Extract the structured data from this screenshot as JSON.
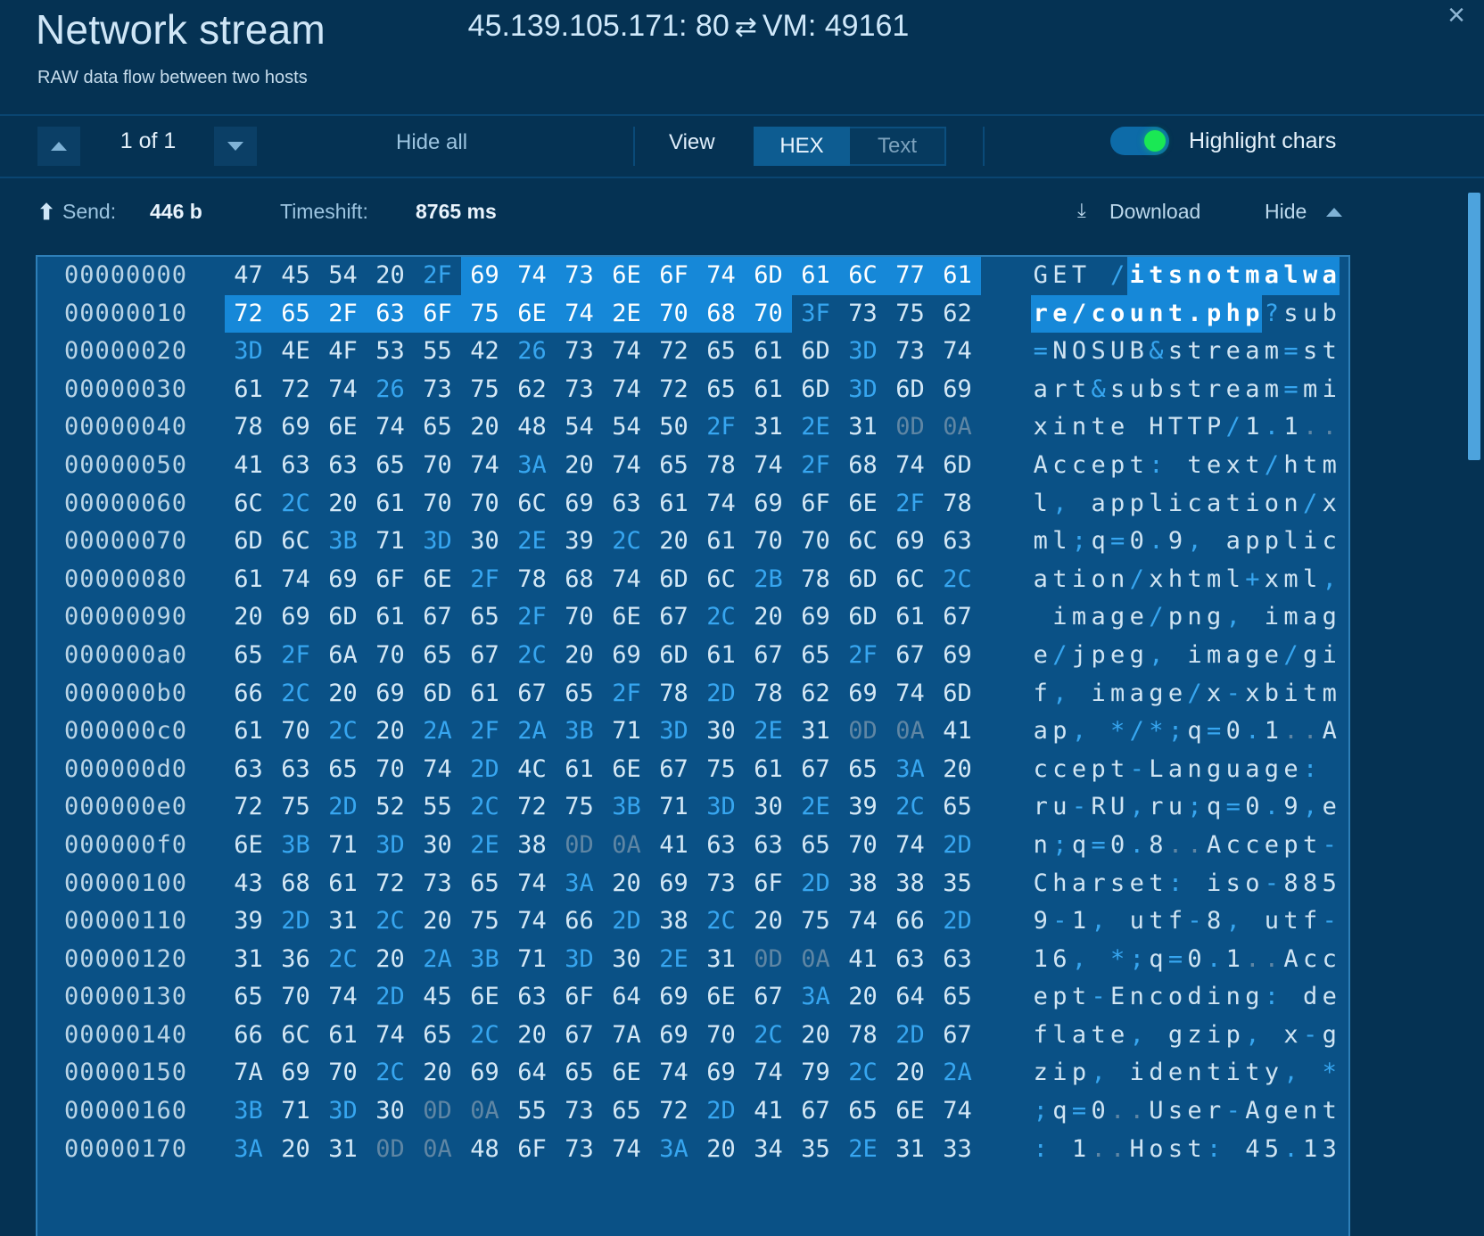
{
  "header": {
    "title": "Network stream",
    "subtitle": "RAW data flow between two hosts",
    "connection": "45.139.105.171: 80",
    "swap_icon": "⇄",
    "connection_right": "VM: 49161",
    "close_icon": "×"
  },
  "toolbar": {
    "prev_icon": "chevron-up-icon",
    "next_icon": "chevron-down-icon",
    "counter": "1 of 1",
    "hide_all": "Hide all",
    "view_label": "View",
    "view_modes": [
      "HEX",
      "Text"
    ],
    "view_selected": "HEX",
    "highlight_chars_label": "Highlight chars",
    "highlight_chars_on": true
  },
  "infobar": {
    "send_arrow": "⬆",
    "send_label": "Send:",
    "send_value": "446 b",
    "timeshift_label": "Timeshift:",
    "timeshift_value": "8765 ms",
    "download_label": "Download",
    "download_icon": "⤓",
    "hide_label": "Hide"
  },
  "colors": {
    "app_bg": "#053253",
    "panel_bg": "#0a5186",
    "panel_border": "#2e7fb8",
    "highlight": "#1688d8",
    "special_char": "#37a6f0",
    "control_char": "#5f86a4",
    "accent_green": "#1ae854",
    "segment_active": "#0d5c91",
    "scrollbar": "#4da3dd"
  },
  "hexdump": {
    "bytes_per_row": 16,
    "rows": [
      {
        "offset": "00000000",
        "hex": [
          "47",
          "45",
          "54",
          "20",
          "2F",
          "69",
          "74",
          "73",
          "6E",
          "6F",
          "74",
          "6D",
          "61",
          "6C",
          "77",
          "61"
        ],
        "ascii": "GET /itsnotmalwa",
        "hl_from": 5,
        "hl_to": 15,
        "ascii_hl_from": 5,
        "ascii_hl_to": 15
      },
      {
        "offset": "00000010",
        "hex": [
          "72",
          "65",
          "2F",
          "63",
          "6F",
          "75",
          "6E",
          "74",
          "2E",
          "70",
          "68",
          "70",
          "3F",
          "73",
          "75",
          "62"
        ],
        "ascii": "re/count.php?sub",
        "hl_from": 0,
        "hl_to": 11,
        "ascii_hl_from": 0,
        "ascii_hl_to": 11
      },
      {
        "offset": "00000020",
        "hex": [
          "3D",
          "4E",
          "4F",
          "53",
          "55",
          "42",
          "26",
          "73",
          "74",
          "72",
          "65",
          "61",
          "6D",
          "3D",
          "73",
          "74"
        ],
        "ascii": "=NOSUB&stream=st",
        "hl_from": -1,
        "hl_to": -1
      },
      {
        "offset": "00000030",
        "hex": [
          "61",
          "72",
          "74",
          "26",
          "73",
          "75",
          "62",
          "73",
          "74",
          "72",
          "65",
          "61",
          "6D",
          "3D",
          "6D",
          "69"
        ],
        "ascii": "art&substream=mi",
        "hl_from": -1,
        "hl_to": -1
      },
      {
        "offset": "00000040",
        "hex": [
          "78",
          "69",
          "6E",
          "74",
          "65",
          "20",
          "48",
          "54",
          "54",
          "50",
          "2F",
          "31",
          "2E",
          "31",
          "0D",
          "0A"
        ],
        "ascii": "xinte HTTP/1.1..",
        "hl_from": -1,
        "hl_to": -1
      },
      {
        "offset": "00000050",
        "hex": [
          "41",
          "63",
          "63",
          "65",
          "70",
          "74",
          "3A",
          "20",
          "74",
          "65",
          "78",
          "74",
          "2F",
          "68",
          "74",
          "6D"
        ],
        "ascii": "Accept: text/htm",
        "hl_from": -1,
        "hl_to": -1
      },
      {
        "offset": "00000060",
        "hex": [
          "6C",
          "2C",
          "20",
          "61",
          "70",
          "70",
          "6C",
          "69",
          "63",
          "61",
          "74",
          "69",
          "6F",
          "6E",
          "2F",
          "78"
        ],
        "ascii": "l, application/x",
        "hl_from": -1,
        "hl_to": -1
      },
      {
        "offset": "00000070",
        "hex": [
          "6D",
          "6C",
          "3B",
          "71",
          "3D",
          "30",
          "2E",
          "39",
          "2C",
          "20",
          "61",
          "70",
          "70",
          "6C",
          "69",
          "63"
        ],
        "ascii": "ml;q=0.9, applic",
        "hl_from": -1,
        "hl_to": -1
      },
      {
        "offset": "00000080",
        "hex": [
          "61",
          "74",
          "69",
          "6F",
          "6E",
          "2F",
          "78",
          "68",
          "74",
          "6D",
          "6C",
          "2B",
          "78",
          "6D",
          "6C",
          "2C"
        ],
        "ascii": "ation/xhtml+xml,",
        "hl_from": -1,
        "hl_to": -1
      },
      {
        "offset": "00000090",
        "hex": [
          "20",
          "69",
          "6D",
          "61",
          "67",
          "65",
          "2F",
          "70",
          "6E",
          "67",
          "2C",
          "20",
          "69",
          "6D",
          "61",
          "67"
        ],
        "ascii": " image/png, imag",
        "hl_from": -1,
        "hl_to": -1
      },
      {
        "offset": "000000a0",
        "hex": [
          "65",
          "2F",
          "6A",
          "70",
          "65",
          "67",
          "2C",
          "20",
          "69",
          "6D",
          "61",
          "67",
          "65",
          "2F",
          "67",
          "69"
        ],
        "ascii": "e/jpeg, image/gi",
        "hl_from": -1,
        "hl_to": -1
      },
      {
        "offset": "000000b0",
        "hex": [
          "66",
          "2C",
          "20",
          "69",
          "6D",
          "61",
          "67",
          "65",
          "2F",
          "78",
          "2D",
          "78",
          "62",
          "69",
          "74",
          "6D"
        ],
        "ascii": "f, image/x-xbitm",
        "hl_from": -1,
        "hl_to": -1
      },
      {
        "offset": "000000c0",
        "hex": [
          "61",
          "70",
          "2C",
          "20",
          "2A",
          "2F",
          "2A",
          "3B",
          "71",
          "3D",
          "30",
          "2E",
          "31",
          "0D",
          "0A",
          "41"
        ],
        "ascii": "ap, */*;q=0.1..A",
        "hl_from": -1,
        "hl_to": -1
      },
      {
        "offset": "000000d0",
        "hex": [
          "63",
          "63",
          "65",
          "70",
          "74",
          "2D",
          "4C",
          "61",
          "6E",
          "67",
          "75",
          "61",
          "67",
          "65",
          "3A",
          "20"
        ],
        "ascii": "ccept-Language: ",
        "hl_from": -1,
        "hl_to": -1
      },
      {
        "offset": "000000e0",
        "hex": [
          "72",
          "75",
          "2D",
          "52",
          "55",
          "2C",
          "72",
          "75",
          "3B",
          "71",
          "3D",
          "30",
          "2E",
          "39",
          "2C",
          "65"
        ],
        "ascii": "ru-RU,ru;q=0.9,e",
        "hl_from": -1,
        "hl_to": -1
      },
      {
        "offset": "000000f0",
        "hex": [
          "6E",
          "3B",
          "71",
          "3D",
          "30",
          "2E",
          "38",
          "0D",
          "0A",
          "41",
          "63",
          "63",
          "65",
          "70",
          "74",
          "2D"
        ],
        "ascii": "n;q=0.8..Accept-",
        "hl_from": -1,
        "hl_to": -1
      },
      {
        "offset": "00000100",
        "hex": [
          "43",
          "68",
          "61",
          "72",
          "73",
          "65",
          "74",
          "3A",
          "20",
          "69",
          "73",
          "6F",
          "2D",
          "38",
          "38",
          "35"
        ],
        "ascii": "Charset: iso-885",
        "hl_from": -1,
        "hl_to": -1
      },
      {
        "offset": "00000110",
        "hex": [
          "39",
          "2D",
          "31",
          "2C",
          "20",
          "75",
          "74",
          "66",
          "2D",
          "38",
          "2C",
          "20",
          "75",
          "74",
          "66",
          "2D"
        ],
        "ascii": "9-1, utf-8, utf-",
        "hl_from": -1,
        "hl_to": -1
      },
      {
        "offset": "00000120",
        "hex": [
          "31",
          "36",
          "2C",
          "20",
          "2A",
          "3B",
          "71",
          "3D",
          "30",
          "2E",
          "31",
          "0D",
          "0A",
          "41",
          "63",
          "63"
        ],
        "ascii": "16, *;q=0.1..Acc",
        "hl_from": -1,
        "hl_to": -1
      },
      {
        "offset": "00000130",
        "hex": [
          "65",
          "70",
          "74",
          "2D",
          "45",
          "6E",
          "63",
          "6F",
          "64",
          "69",
          "6E",
          "67",
          "3A",
          "20",
          "64",
          "65"
        ],
        "ascii": "ept-Encoding: de",
        "hl_from": -1,
        "hl_to": -1
      },
      {
        "offset": "00000140",
        "hex": [
          "66",
          "6C",
          "61",
          "74",
          "65",
          "2C",
          "20",
          "67",
          "7A",
          "69",
          "70",
          "2C",
          "20",
          "78",
          "2D",
          "67"
        ],
        "ascii": "flate, gzip, x-g",
        "hl_from": -1,
        "hl_to": -1
      },
      {
        "offset": "00000150",
        "hex": [
          "7A",
          "69",
          "70",
          "2C",
          "20",
          "69",
          "64",
          "65",
          "6E",
          "74",
          "69",
          "74",
          "79",
          "2C",
          "20",
          "2A"
        ],
        "ascii": "zip, identity, *",
        "hl_from": -1,
        "hl_to": -1
      },
      {
        "offset": "00000160",
        "hex": [
          "3B",
          "71",
          "3D",
          "30",
          "0D",
          "0A",
          "55",
          "73",
          "65",
          "72",
          "2D",
          "41",
          "67",
          "65",
          "6E",
          "74"
        ],
        "ascii": ";q=0..User-Agent",
        "hl_from": -1,
        "hl_to": -1
      },
      {
        "offset": "00000170",
        "hex": [
          "3A",
          "20",
          "31",
          "0D",
          "0A",
          "48",
          "6F",
          "73",
          "74",
          "3A",
          "20",
          "34",
          "35",
          "2E",
          "31",
          "33"
        ],
        "ascii": ": 1..Host: 45.13",
        "hl_from": -1,
        "hl_to": -1
      }
    ]
  }
}
